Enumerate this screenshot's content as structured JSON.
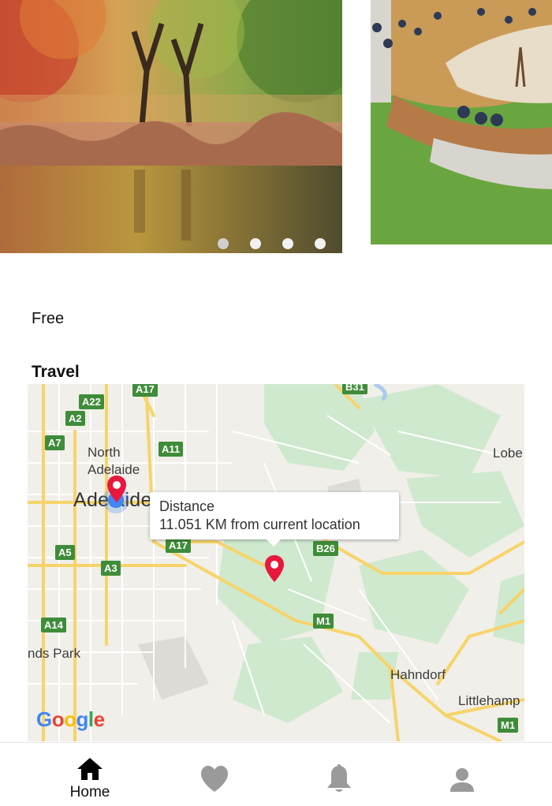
{
  "carousel": {
    "slide_count": 4,
    "active_index": 0
  },
  "details": {
    "price": "Free"
  },
  "travel": {
    "title": "Travel",
    "map": {
      "labels": {
        "north_adelaide": "North\nAdelaide",
        "adelaide": "Adelaide",
        "lobe": "Lobe",
        "hahndorf": "Hahndorf",
        "littlehamp": "Littlehamp",
        "nds_park": "nds Park"
      },
      "shields": [
        "A17",
        "B31",
        "A22",
        "A2",
        "A7",
        "A11",
        "A17",
        "B26",
        "A5",
        "A3",
        "A14",
        "M1",
        "M1"
      ],
      "info_window": {
        "title": "Distance",
        "body": "11.051 KM from current location"
      },
      "attribution": "Google"
    }
  },
  "tabbar": {
    "tabs": [
      {
        "label": "Home",
        "icon": "home-icon",
        "active": true
      },
      {
        "label": "",
        "icon": "heart-icon",
        "active": false
      },
      {
        "label": "",
        "icon": "bell-icon",
        "active": false
      },
      {
        "label": "",
        "icon": "person-icon",
        "active": false
      }
    ]
  },
  "colors": {
    "active_tab": "#000000",
    "inactive_tab": "#9a9a9a",
    "road_shield": "#3f8c3a",
    "pin": "#e8173c"
  }
}
